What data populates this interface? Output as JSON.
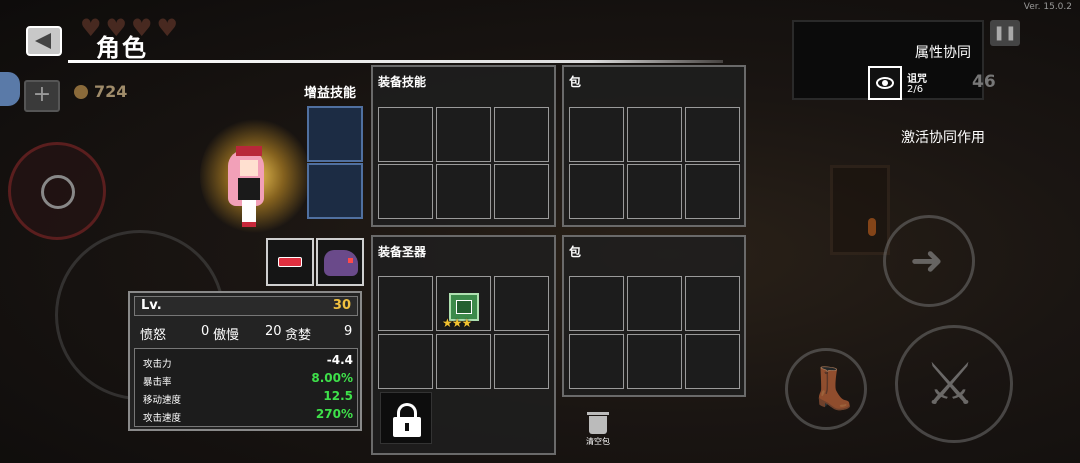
{
  "header": {
    "title": "角色"
  },
  "hud": {
    "coins": "724",
    "gems": "46",
    "version": "Ver. 15.0.2"
  },
  "character": {
    "bonus_skill_label": "增益技能",
    "stats": {
      "level_label": "Lv.",
      "level": "30",
      "curses": [
        {
          "label": "愤怒",
          "value": "0"
        },
        {
          "label": "傲慢",
          "value": "20"
        },
        {
          "label": "贪婪",
          "value": "9"
        }
      ],
      "attributes": [
        {
          "label": "攻击力",
          "value": "-4.4",
          "color": "#ffffff"
        },
        {
          "label": "暴击率",
          "value": "8.00%",
          "color": "#3ee04a"
        },
        {
          "label": "移动速度",
          "value": "12.5",
          "color": "#3ee04a"
        },
        {
          "label": "攻击速度",
          "value": "270%",
          "color": "#3ee04a"
        }
      ]
    }
  },
  "panels": {
    "equip_skill": {
      "title": "装备技能"
    },
    "bag_top": {
      "title": "包"
    },
    "equip_relic": {
      "title": "装备圣器"
    },
    "bag_bottom": {
      "title": "包"
    }
  },
  "clear_bag_label": "清空包",
  "synergy": {
    "title": "属性协同",
    "item": {
      "name": "诅咒",
      "count": "2/6",
      "icon": "eye-icon"
    },
    "activate_label": "激活协同作用"
  }
}
